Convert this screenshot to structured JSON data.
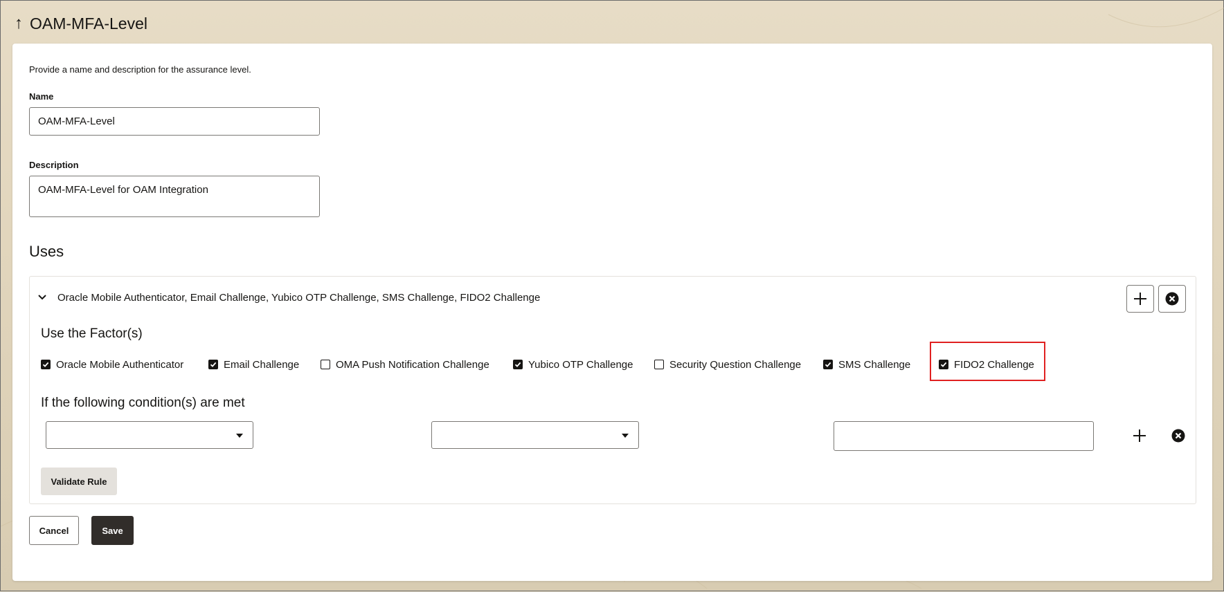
{
  "header": {
    "title": "OAM-MFA-Level",
    "back_icon": "arrow-up-icon"
  },
  "form": {
    "intro": "Provide a name and description for the assurance level.",
    "name_label": "Name",
    "name_value": "OAM-MFA-Level",
    "description_label": "Description",
    "description_value": "OAM-MFA-Level for OAM Integration"
  },
  "uses": {
    "heading": "Uses",
    "rule": {
      "summary": "Oracle Mobile Authenticator, Email Challenge, Yubico OTP Challenge, SMS Challenge, FIDO2 Challenge",
      "factors_heading": "Use the Factor(s)",
      "factors": [
        {
          "label": "Oracle Mobile Authenticator",
          "checked": true
        },
        {
          "label": "Email Challenge",
          "checked": true
        },
        {
          "label": "OMA Push Notification Challenge",
          "checked": false
        },
        {
          "label": "Yubico OTP Challenge",
          "checked": true
        },
        {
          "label": "Security Question Challenge",
          "checked": false
        },
        {
          "label": "SMS Challenge",
          "checked": true
        },
        {
          "label": "FIDO2 Challenge",
          "checked": true
        }
      ],
      "highlighted_factor": "FIDO2 Challenge",
      "conditions_heading": "If the following condition(s) are met",
      "condition": {
        "attribute_value": "",
        "operator_value": "",
        "value": ""
      },
      "validate_label": "Validate Rule"
    }
  },
  "actions": {
    "cancel_label": "Cancel",
    "save_label": "Save"
  },
  "colors": {
    "highlight": "#e02020",
    "primary_button": "#312d2a",
    "secondary_button": "#e4e1dc"
  }
}
